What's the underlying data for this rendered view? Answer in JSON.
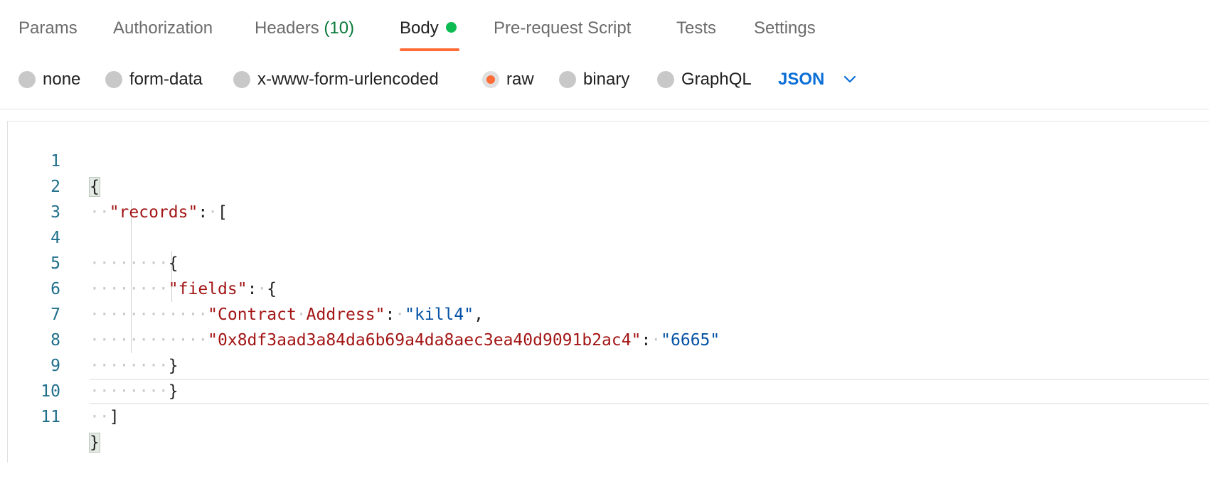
{
  "tabs": [
    {
      "label": "Params"
    },
    {
      "label": "Authorization"
    },
    {
      "label": "Headers",
      "count": "(10)"
    },
    {
      "label": "Body"
    },
    {
      "label": "Pre-request Script"
    },
    {
      "label": "Tests"
    },
    {
      "label": "Settings"
    }
  ],
  "body_types": {
    "options": [
      "none",
      "form-data",
      "x-www-form-urlencoded",
      "raw",
      "binary",
      "GraphQL"
    ],
    "selected": "raw",
    "language": "JSON"
  },
  "editor": {
    "line_numbers": [
      "1",
      "2",
      "3",
      "4",
      "5",
      "6",
      "7",
      "8",
      "9",
      "10",
      "11"
    ],
    "lines": [
      "{",
      "  \"records\": [",
      "",
      "        {",
      "        \"fields\": {",
      "            \"Contract Address\": \"kill4\",",
      "            \"0x8df3aad3a84da6b69a4da8aec3ea40d9091b2ac4\": \"6665\"",
      "        }",
      "        }",
      "  ]",
      "}"
    ]
  },
  "colors": {
    "accent": "#ff6c37",
    "active_dot": "#0cbb52",
    "count_green": "#0b7a3a",
    "json_link": "#0b6fd6",
    "key": "#a31515",
    "string": "#0451a5",
    "line_number": "#1f6f8b"
  }
}
